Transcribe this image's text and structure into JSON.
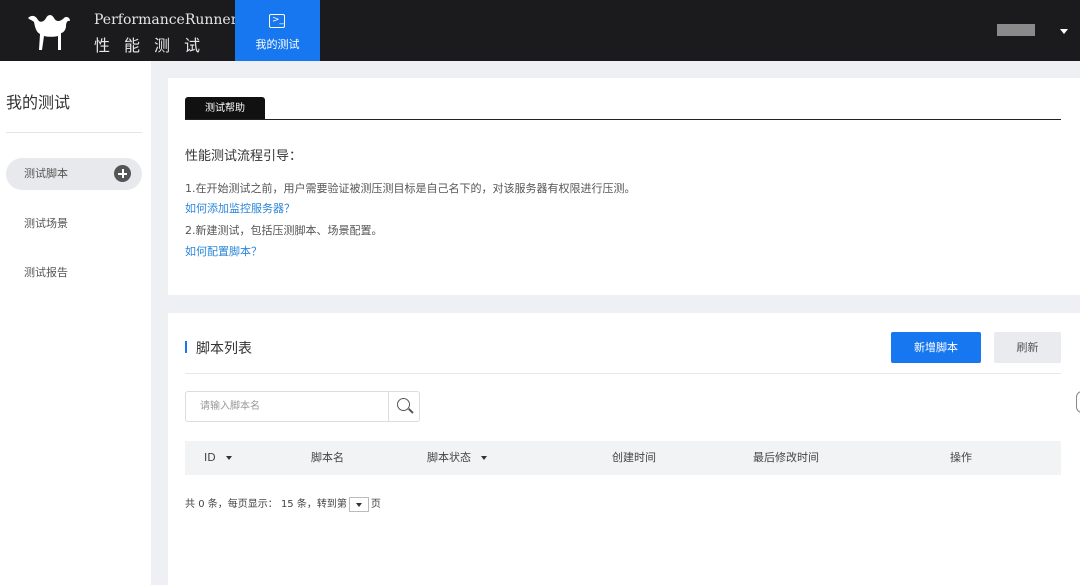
{
  "header": {
    "brand_en": "PerformanceRunner",
    "brand_cn": "性能测试",
    "nav_active_label": "我的测试",
    "nav_icon": "terminal-icon",
    "user_menu_icon": "caret-down-icon",
    "accent_color": "#1677f0",
    "bar_color": "#1b1b1d"
  },
  "sidebar": {
    "title": "我的测试",
    "items": [
      {
        "label": "测试脚本",
        "active": true
      },
      {
        "label": "测试场景",
        "active": false
      },
      {
        "label": "测试报告",
        "active": false
      }
    ]
  },
  "help": {
    "tab_label": "测试帮助",
    "title": "性能测试流程引导：",
    "step1": "1.在开始测试之前，用户需要验证被测压测目标是自己名下的，对该服务器有权限进行压测。",
    "link1": "如何添加监控服务器？",
    "step2": "2.新建测试，包括压测脚本、场景配置。",
    "link2": "如何配置脚本？",
    "link_color": "#2b86d8"
  },
  "scripts": {
    "title": "脚本列表",
    "new_button": "新增脚本",
    "refresh_button": "刷新",
    "search_placeholder": "请输入脚本名",
    "columns": [
      "ID",
      "脚本名",
      "脚本状态",
      "创建时间",
      "最后修改时间",
      "操作"
    ],
    "rows": [],
    "pager": {
      "total_prefix": "共",
      "total_count": "0",
      "total_suffix": "条，每页显示：",
      "page_size": "15",
      "page_size_suffix": "条，转到第",
      "page_suffix": "页"
    }
  }
}
